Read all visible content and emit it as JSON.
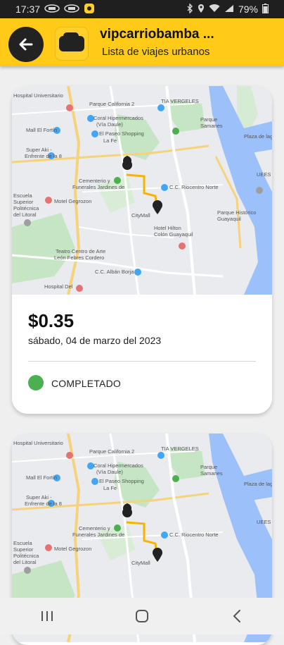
{
  "status_bar": {
    "time": "17:37",
    "battery": "79%",
    "icons": [
      "notification-icon",
      "notification-icon",
      "app-icon",
      "bluetooth-icon",
      "location-icon",
      "wifi-icon",
      "signal-icon",
      "battery-icon"
    ]
  },
  "app_bar": {
    "title": "vipcarriobamba ...",
    "subtitle": "Lista de viajes urbanos",
    "back_icon": "arrow-left-icon",
    "color": "#ffca18"
  },
  "map_labels": {
    "hospital_universitario": "Hospital Universitario",
    "parque_california": "Parque California 2",
    "coral": "Coral Hipermercados",
    "via_daule": "(Vía Daule)",
    "el_paseo": "El Paseo Shopping",
    "la_fe": "La Fe",
    "mall_fortin": "Mall El Fortín",
    "super_aki": "Super Aki -",
    "enfrente": "Enfrente de la 8",
    "cementerio": "Cementerio y",
    "jardines": "Funerales Jardines de",
    "motel": "Motel Gegrozon",
    "escuela": "Escuela",
    "superior": "Superior",
    "politecnica": "Politécnica",
    "litoral": "del Litoral",
    "teatro": "Teatro Centro de Arte",
    "leon": "León Febres Cordero",
    "hotel": "Hotel Hilton",
    "colon": "Colón Guayaquil",
    "city_mall": "CityMall",
    "cc_albán": "C.C. Albán Borja",
    "hospital_del": "Hospital Del",
    "tia": "TIA VERGELES",
    "parque_samanes": "Parque",
    "samanes": "Samanes",
    "plaza_lagos": "Plaza de lagos",
    "cc_riocentro": "C.C. Riocentro Norte",
    "parque_historico": "Parque Histórico",
    "guayaquil": "Guayaquil",
    "uees": "UEES",
    "via_daule_road": "Vía Daule"
  },
  "trips": [
    {
      "price": "$0.35",
      "date": "sábado, 04 de marzo del 2023",
      "status": "COMPLETADO",
      "status_color": "#4caf50"
    },
    {
      "price": "",
      "date": "",
      "status": "",
      "status_color": "#4caf50"
    }
  ],
  "nav_bar": {
    "icons": [
      "recents-icon",
      "home-icon",
      "back-icon"
    ]
  }
}
